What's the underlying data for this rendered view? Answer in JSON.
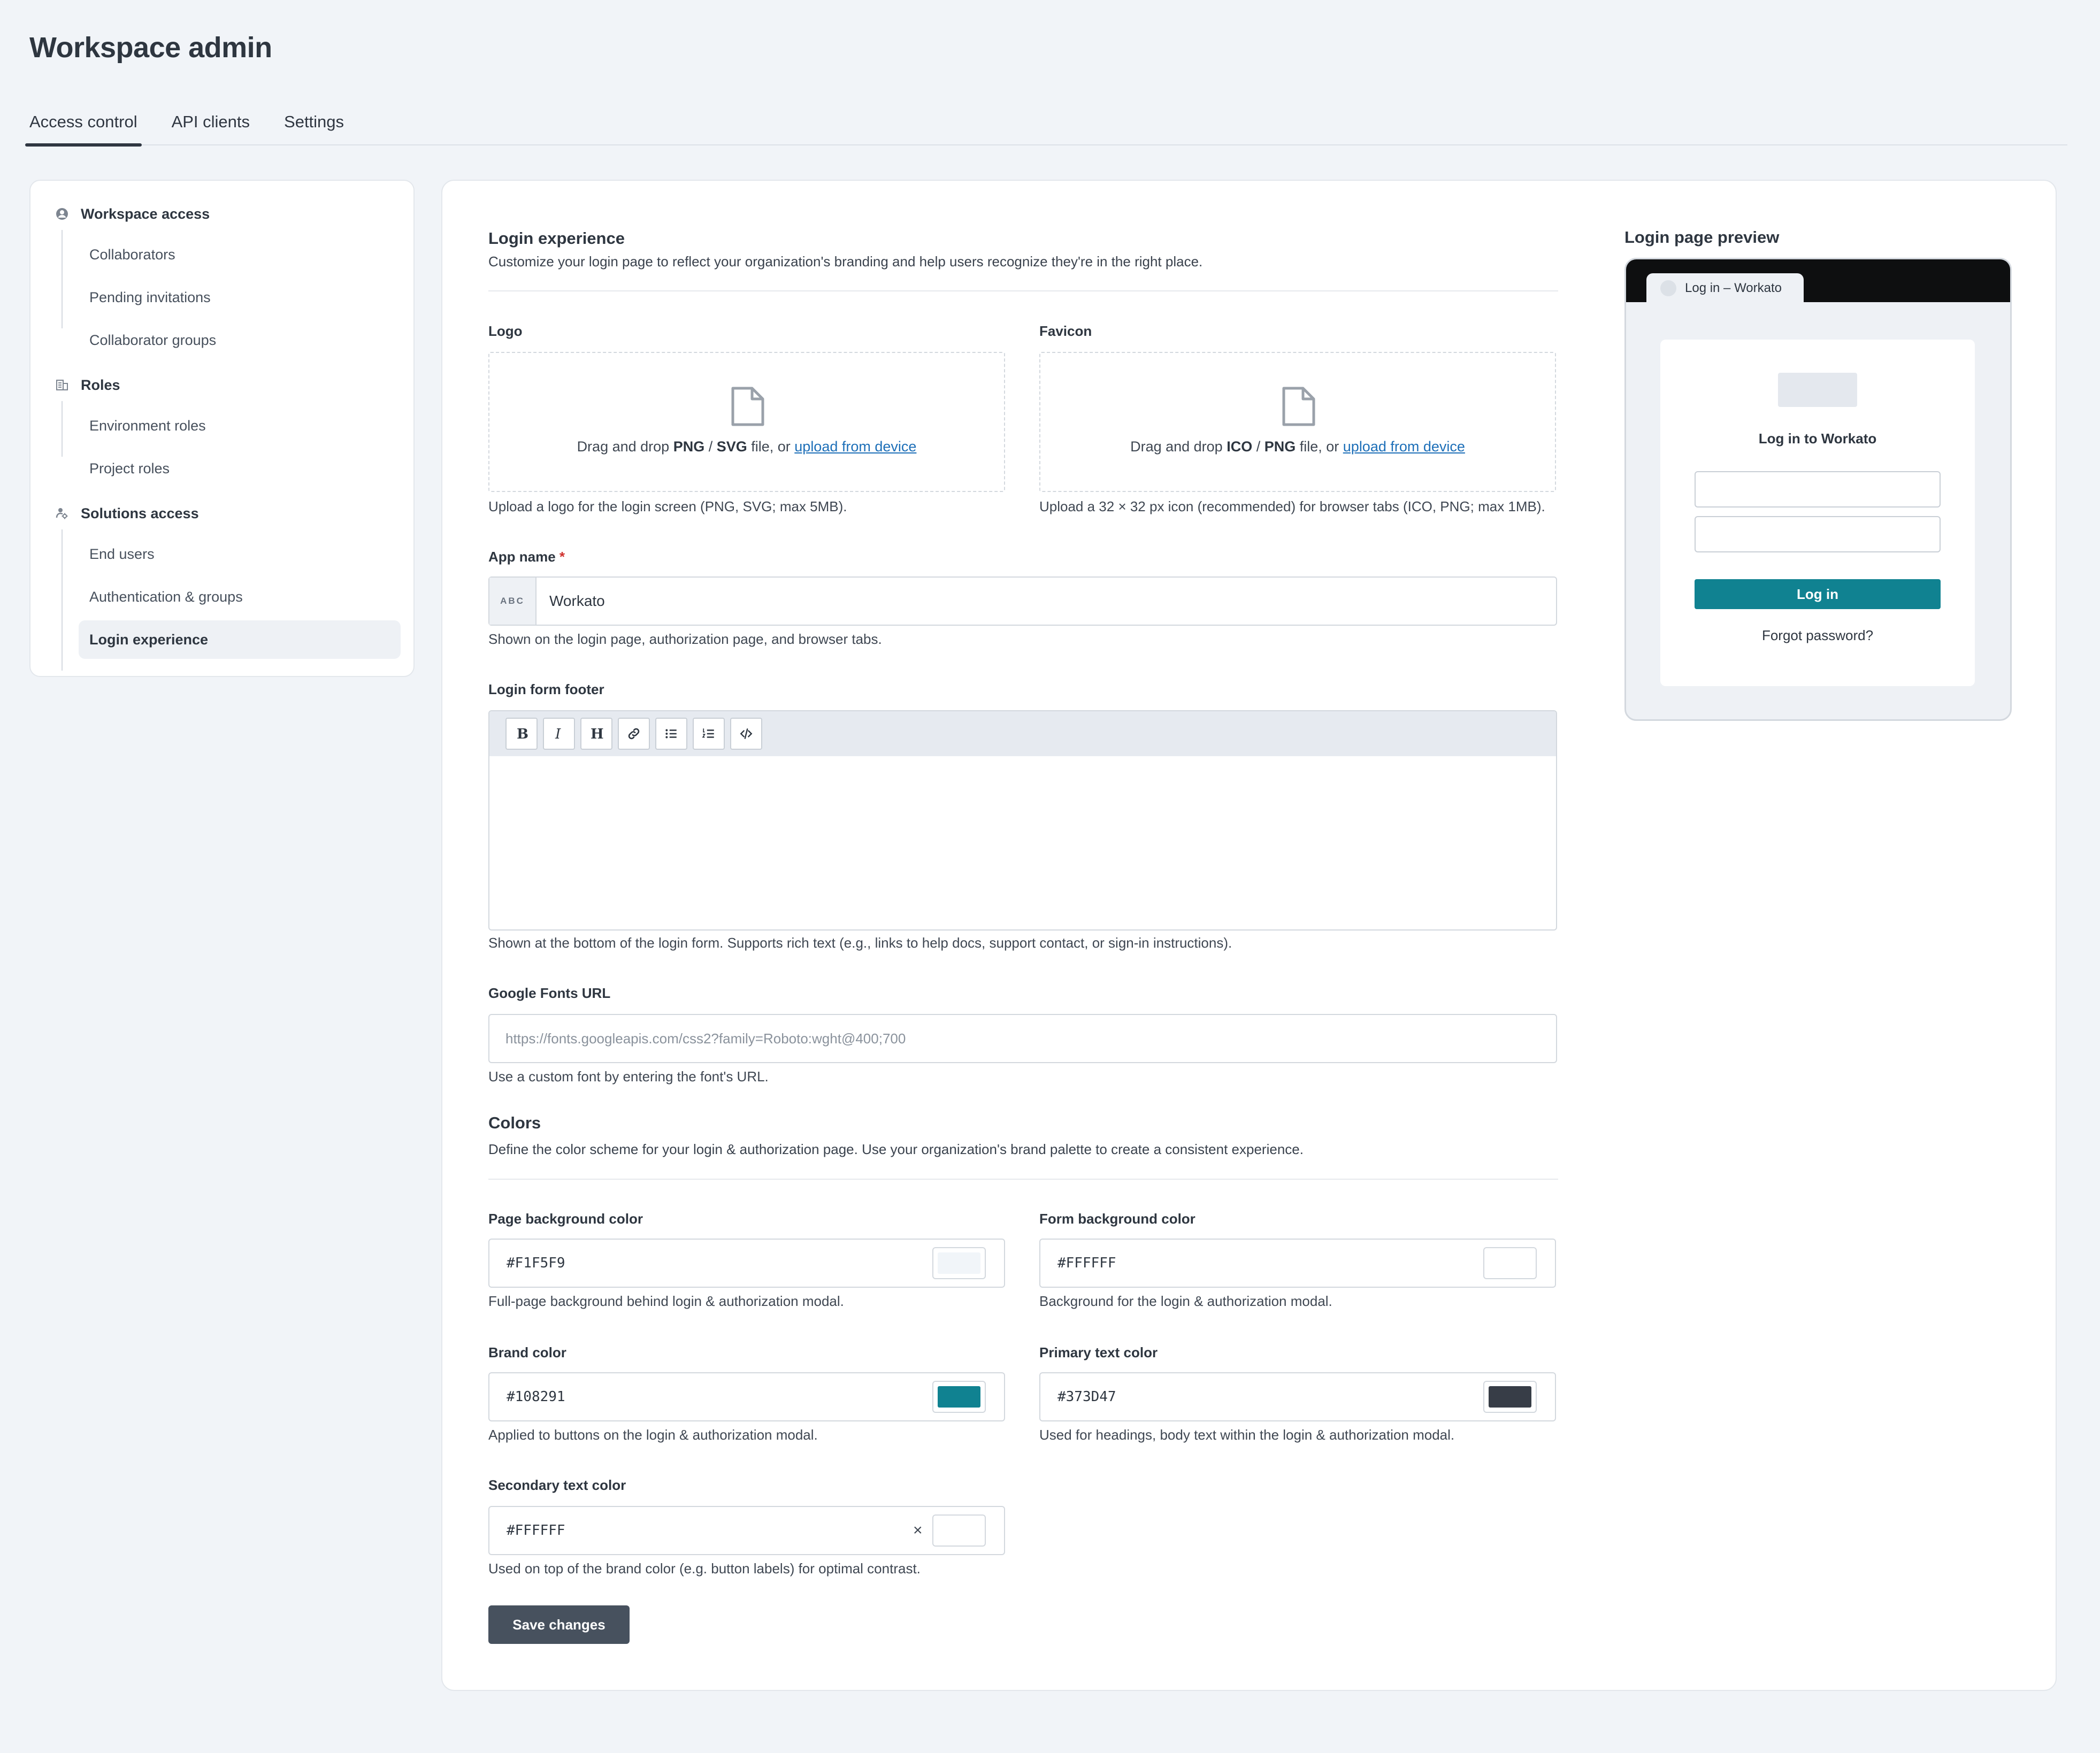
{
  "page": {
    "title": "Workspace admin"
  },
  "tabs": [
    {
      "label": "Access control",
      "active": true
    },
    {
      "label": "API clients"
    },
    {
      "label": "Settings"
    }
  ],
  "sidebar": {
    "groups": [
      {
        "label": "Workspace access",
        "icon": "user-circle-icon",
        "items": [
          "Collaborators",
          "Pending invitations",
          "Collaborator groups"
        ]
      },
      {
        "label": "Roles",
        "icon": "roles-icon",
        "items": [
          "Environment roles",
          "Project roles"
        ]
      },
      {
        "label": "Solutions access",
        "icon": "solutions-icon",
        "items": [
          "End users",
          "Authentication & groups",
          "Login experience"
        ]
      }
    ],
    "active_item": "Login experience"
  },
  "login_experience": {
    "title": "Login experience",
    "description": "Customize your login page to reflect your organization's branding and help users recognize they're in the right place."
  },
  "logo": {
    "label": "Logo",
    "drop_prefix": "Drag and drop ",
    "format_1": "PNG",
    "sep": " / ",
    "format_2": "SVG",
    "drop_suffix": " file, or ",
    "link": "upload from device",
    "help": "Upload a logo for the login screen (PNG, SVG; max 5MB)."
  },
  "favicon": {
    "label": "Favicon",
    "drop_prefix": "Drag and drop ",
    "format_1": "ICO",
    "sep": " / ",
    "format_2": "PNG",
    "drop_suffix": " file, or ",
    "link": "upload from device",
    "help": "Upload a 32 × 32 px icon (recommended) for browser tabs (ICO, PNG; max 1MB)."
  },
  "app_name": {
    "label": "App name",
    "required_mark": "*",
    "prefix": "ABC",
    "value": "Workato",
    "help": "Shown on the login page, authorization page, and browser tabs."
  },
  "footer_editor": {
    "label": "Login form footer",
    "toolbar": [
      "bold-icon",
      "italic-icon",
      "heading-icon",
      "link-icon",
      "bullet-list-icon",
      "numbered-list-icon",
      "code-icon"
    ],
    "help": "Shown at the bottom of the login form. Supports rich text (e.g., links to help docs, support contact, or sign-in instructions)."
  },
  "google_fonts": {
    "label": "Google Fonts URL",
    "placeholder": "https://fonts.googleapis.com/css2?family=Roboto:wght@400;700",
    "help": "Use a custom font by entering the font's URL."
  },
  "colors": {
    "title": "Colors",
    "description": "Define the color scheme for your login & authorization page. Use your organization's brand palette to create a consistent experience.",
    "page_bg": {
      "label": "Page background color",
      "value": "#F1F5F9",
      "help": "Full-page background behind login & authorization modal."
    },
    "form_bg": {
      "label": "Form background color",
      "value": "#FFFFFF",
      "help": "Background for the login & authorization modal."
    },
    "brand": {
      "label": "Brand color",
      "value": "#108291",
      "help": "Applied to buttons on the login & authorization modal."
    },
    "primary_text": {
      "label": "Primary text color",
      "value": "#373D47",
      "help": "Used for headings, body text within the login & authorization modal."
    },
    "secondary_text": {
      "label": "Secondary text color",
      "value": "#FFFFFF",
      "clear": "×",
      "help": "Used on top of the brand color (e.g. button labels) for optimal contrast."
    }
  },
  "save": {
    "label": "Save changes"
  },
  "preview": {
    "title": "Login page preview",
    "tab_label": "Log in – Workato",
    "heading": "Log in to Workato",
    "button": "Log in",
    "forgot": "Forgot password?"
  }
}
